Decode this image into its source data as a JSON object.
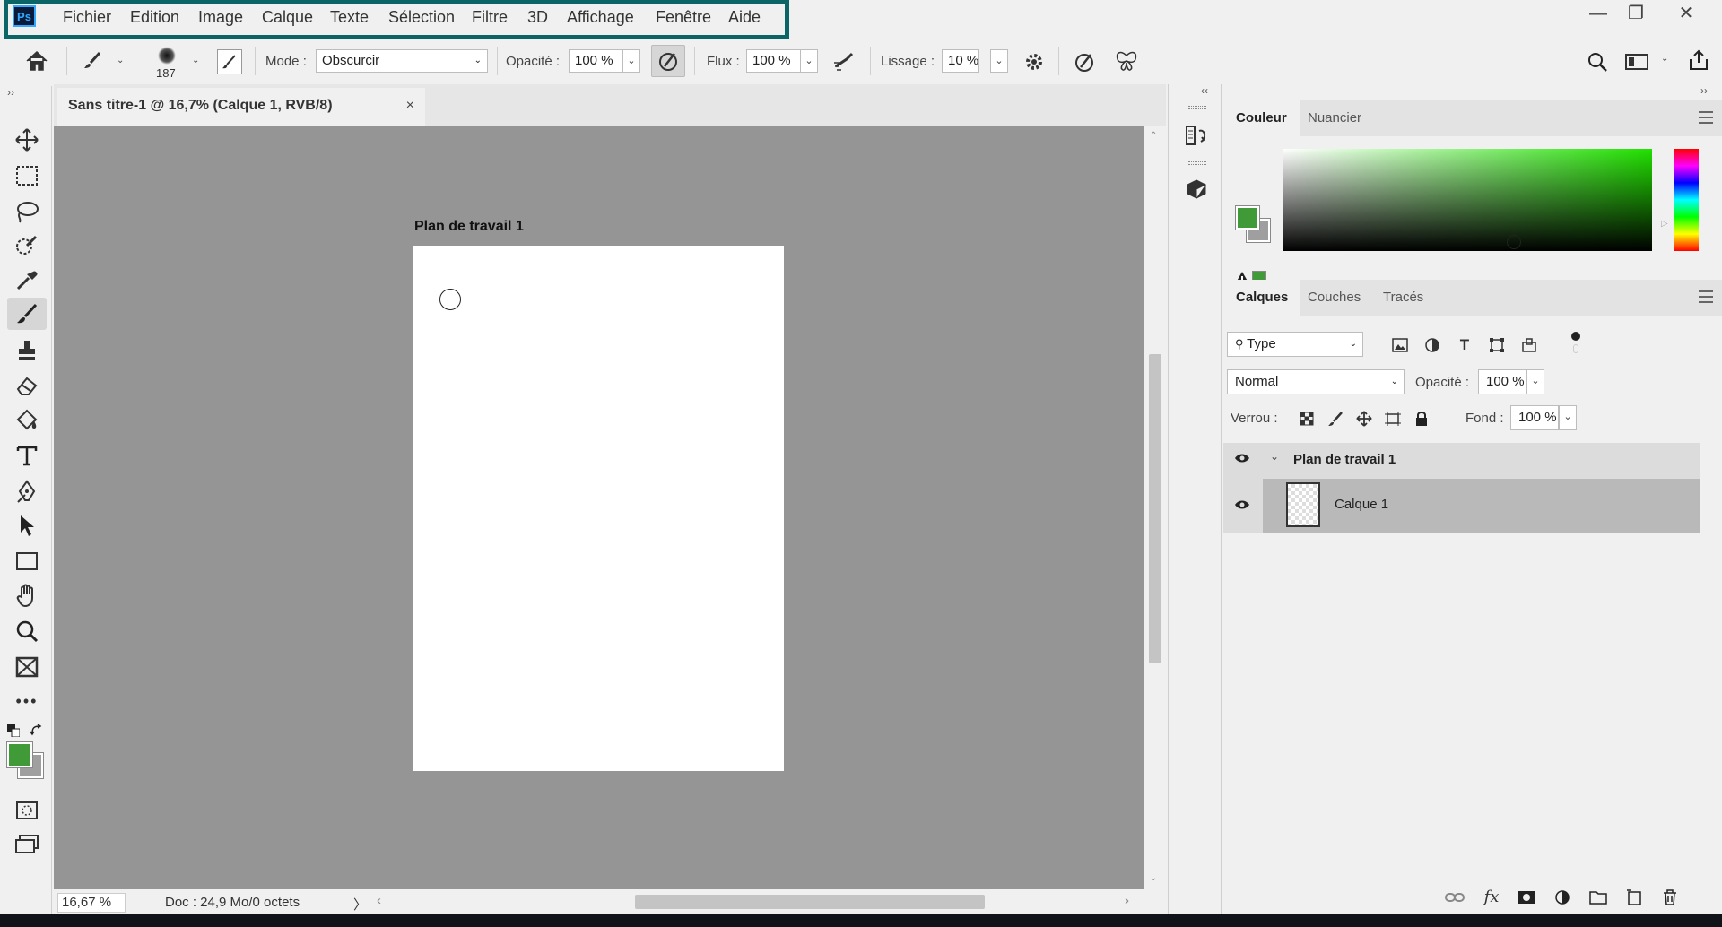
{
  "app": {
    "logo": "Ps"
  },
  "menu": [
    "Fichier",
    "Edition",
    "Image",
    "Calque",
    "Texte",
    "Sélection",
    "Filtre",
    "3D",
    "Affichage",
    "Fenêtre",
    "Aide"
  ],
  "window_controls": {
    "minimize": "—",
    "restore": "❐",
    "close": "✕"
  },
  "options_bar": {
    "brush_size": "187",
    "mode_label": "Mode :",
    "mode_value": "Obscurcir",
    "opacity_label": "Opacité :",
    "opacity_value": "100 %",
    "flow_label": "Flux :",
    "flow_value": "100 %",
    "smoothing_label": "Lissage :",
    "smoothing_value": "10 %"
  },
  "document": {
    "tab_title": "Sans titre-1 @ 16,7% (Calque 1, RVB/8)",
    "close": "×",
    "artboard_title": "Plan de travail 1"
  },
  "status": {
    "zoom": "16,67 %",
    "doc_info": "Doc : 24,9 Mo/0 octets",
    "arrow": "〉"
  },
  "color_panel": {
    "tabs": [
      "Couleur",
      "Nuancier"
    ],
    "foreground": "#3f9a37",
    "background": "#9f9f9f"
  },
  "layers_panel": {
    "tabs": [
      "Calques",
      "Couches",
      "Tracés"
    ],
    "filter_kind": "Type",
    "blend_mode": "Normal",
    "opacity_label": "Opacité :",
    "opacity_value": "100 %",
    "lock_label": "Verrou :",
    "fill_label": "Fond :",
    "fill_value": "100 %",
    "group_name": "Plan de travail 1",
    "layer_name": "Calque 1"
  }
}
